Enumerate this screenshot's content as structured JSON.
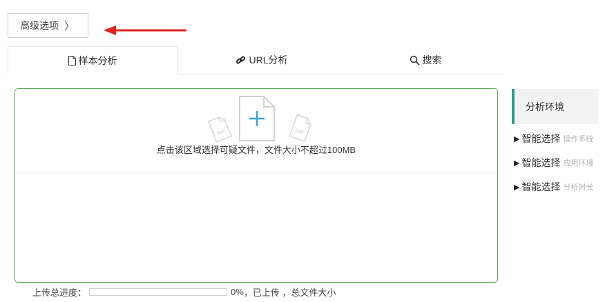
{
  "advanced_button": {
    "label": "高级选项",
    "chevron": "〉"
  },
  "tabs": [
    {
      "label": "样本分析",
      "icon": "file-icon"
    },
    {
      "label": "URL分析",
      "icon": "link-icon"
    },
    {
      "label": "搜索",
      "icon": "search-icon"
    }
  ],
  "upload": {
    "hint": "点击该区域选择可疑文件，文件大小不超过100MB",
    "exe_label": "exe",
    "pdf_label": "pdf"
  },
  "progress": {
    "label": "上传总进度：",
    "percent_text": "0%",
    "percent": 0,
    "uploaded_text": "，已上传 ，总文件大小"
  },
  "sidebar": {
    "title": "分析环境",
    "items": [
      {
        "label": "智能选择",
        "sub": "操作系统"
      },
      {
        "label": "智能选择",
        "sub": "应用环境"
      },
      {
        "label": "智能选择",
        "sub": "分析时长"
      }
    ]
  },
  "colors": {
    "accent_green": "#5aa35a",
    "sidebar_accent": "#2a9d8f",
    "arrow_red": "#e02020",
    "plus_blue": "#3aa0e0"
  }
}
